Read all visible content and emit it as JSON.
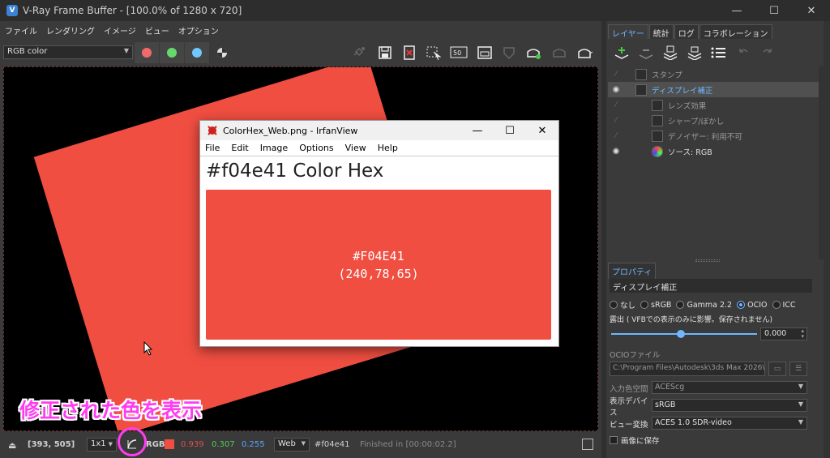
{
  "window": {
    "title": "V-Ray Frame Buffer - [100.0% of 1280 x 720]",
    "minimize": "—",
    "maximize": "☐",
    "close": "✕"
  },
  "menu": [
    "ファイル",
    "レンダリング",
    "イメージ",
    "ビュー",
    "オプション"
  ],
  "toolbar": {
    "channel": "RGB color",
    "channel_colors": {
      "red": "#f26b6b",
      "green": "#66d96b",
      "blue": "#6fc8ff"
    }
  },
  "irfanview": {
    "title": "ColorHex_Web.png - IrfanView",
    "menu": [
      "File",
      "Edit",
      "Image",
      "Options",
      "View",
      "Help"
    ],
    "heading": "#f04e41 Color Hex",
    "hex_label": "#F04E41",
    "rgb_label": "(240,78,65)",
    "swatch_color": "#f04e41"
  },
  "right_panel": {
    "tabs": [
      "レイヤー",
      "統計",
      "ログ",
      "コラボレーション"
    ],
    "layers": [
      {
        "label": "スタンプ",
        "visible": false
      },
      {
        "label": "ディスプレイ補正",
        "visible": true,
        "selected": true
      },
      {
        "label": "レンズ効果",
        "visible": false
      },
      {
        "label": "シャープ/ぼかし",
        "visible": false
      },
      {
        "label": "デノイザー: 利用不可",
        "visible": false
      },
      {
        "label": "ソース: RGB",
        "visible": true
      }
    ],
    "properties_tab": "プロパティ",
    "properties_header": "ディスプレイ補正",
    "radio_options": [
      "なし",
      "sRGB",
      "Gamma 2.2",
      "OCIO",
      "ICC"
    ],
    "radio_selected": "OCIO",
    "exposure_label": "露出 ( VFBでの表示のみに影響。保存されません)",
    "exposure_value": "0.000",
    "exposure_level": 0.48,
    "ocio_label": "OCIOファイル",
    "ocio_path": "C:\\Program Files\\Autodesk\\3ds Max 2026\\Co",
    "input_space_label": "入力色空間",
    "input_space_value": "ACEScg",
    "display_device_label": "表示デバイス",
    "display_device_value": "sRGB",
    "view_transform_label": "ビュー変換",
    "view_transform_value": "ACES 1.0 SDR-video",
    "save_to_image_label": "画像に保存"
  },
  "statusbar": {
    "coords": "[393, 505]",
    "zoom": "1x1",
    "rgb_label": "RGB",
    "swatch_color": "#f04e41",
    "r_value": "0.939",
    "g_value": "0.307",
    "b_value": "0.255",
    "color_space": "Web",
    "hex": "#f04e41",
    "finished": "Finished in [00:00:02.2]"
  },
  "annotation": "修正された色を表示"
}
